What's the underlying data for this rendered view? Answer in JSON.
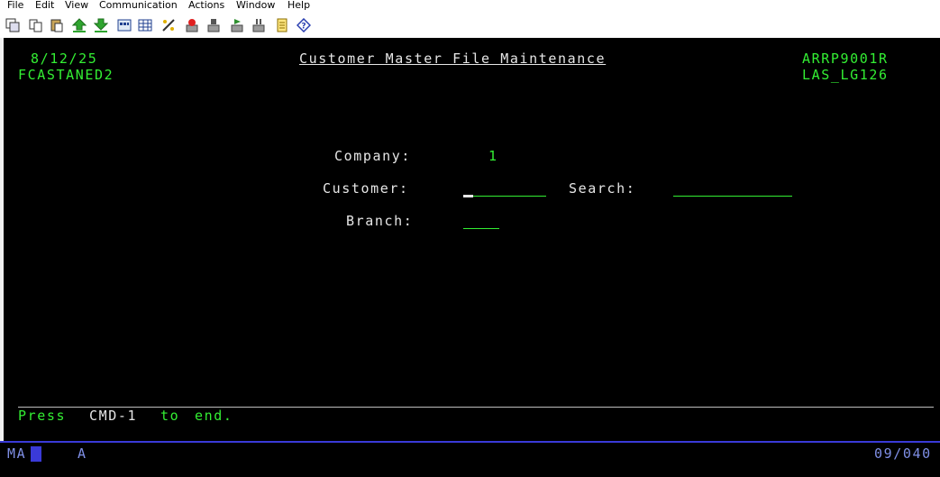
{
  "menu": [
    "File",
    "Edit",
    "View",
    "Communication",
    "Actions",
    "Window",
    "Help"
  ],
  "toolbar": {
    "icons": [
      "copy-screen-icon",
      "copy-icon",
      "paste-icon",
      "send-file-icon",
      "receive-file-icon",
      "display-keypad-icon",
      "quick-keys-icon",
      "macro-icon",
      "record-macro-icon",
      "stop-macro-icon",
      "play-macro-icon",
      "pause-macro-icon",
      "notes-icon",
      "help-icon"
    ]
  },
  "screen": {
    "date": "8/12/25",
    "user": "FCASTANED2",
    "title": "Customer Master File Maintenance",
    "program": "ARRP9001R",
    "device": "LAS_LG126",
    "company_label": "Company:",
    "company_value": "1",
    "customer_label": "Customer:",
    "customer_value": "",
    "search_label": "Search:",
    "search_value": "",
    "branch_label": "Branch:",
    "branch_value": "",
    "footer_press": "Press",
    "footer_cmd": "CMD-1",
    "footer_to": "to",
    "footer_end": "end."
  },
  "status_bar": {
    "mode": "MA",
    "indicator": "A",
    "cursor_position": "09/040"
  }
}
